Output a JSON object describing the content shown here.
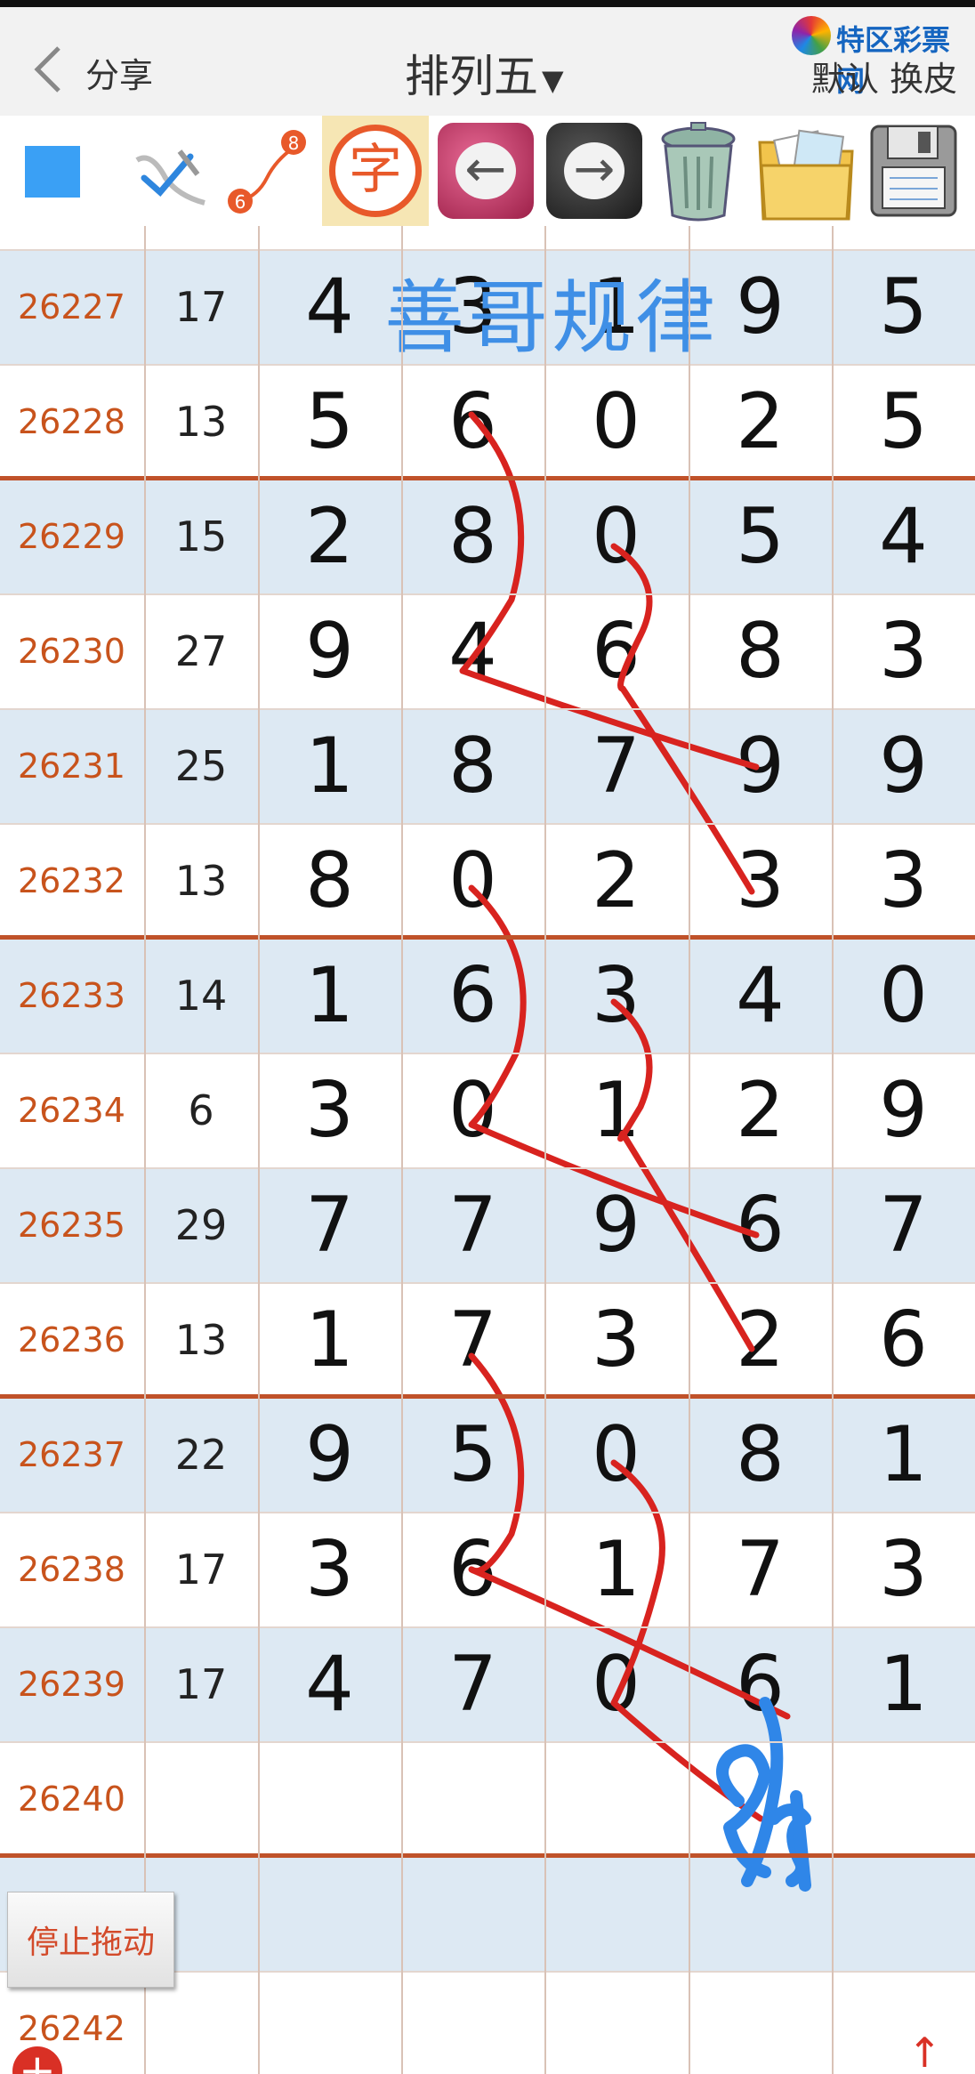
{
  "header": {
    "share_label": "分享",
    "title": "排列五",
    "logo_text": "特区彩票网",
    "skin_label": "默认 换皮"
  },
  "icons": {
    "back": "chevron-left-icon",
    "dropdown": "caret-down-icon",
    "color_swatch": "blue-square-icon",
    "pen": "pen-check-icon",
    "path": "route-6-8-icon",
    "text": "text-char-icon",
    "undo": "arrow-left-icon",
    "redo": "arrow-right-icon",
    "trash": "trash-can-icon",
    "folder": "photo-folder-icon",
    "save": "floppy-disk-icon"
  },
  "toolbar": {
    "path_from": "6",
    "path_to": "8",
    "char_label": "字"
  },
  "overlay": {
    "watermark": "善哥规律",
    "annotation": "94",
    "stroke_color": "#d8231f",
    "annotation_color": "#2f86e8"
  },
  "rows": [
    {
      "issue": "26227",
      "sum": "17",
      "d": [
        "4",
        "3",
        "1",
        "9",
        "5"
      ]
    },
    {
      "issue": "26228",
      "sum": "13",
      "d": [
        "5",
        "6",
        "0",
        "2",
        "5"
      ]
    },
    {
      "issue": "26229",
      "sum": "15",
      "d": [
        "2",
        "8",
        "0",
        "5",
        "4"
      ]
    },
    {
      "issue": "26230",
      "sum": "27",
      "d": [
        "9",
        "4",
        "6",
        "8",
        "3"
      ]
    },
    {
      "issue": "26231",
      "sum": "25",
      "d": [
        "1",
        "8",
        "7",
        "9",
        "9"
      ]
    },
    {
      "issue": "26232",
      "sum": "13",
      "d": [
        "8",
        "0",
        "2",
        "3",
        "3"
      ]
    },
    {
      "issue": "26233",
      "sum": "14",
      "d": [
        "1",
        "6",
        "3",
        "4",
        "0"
      ]
    },
    {
      "issue": "26234",
      "sum": "6",
      "d": [
        "3",
        "0",
        "1",
        "2",
        "9"
      ]
    },
    {
      "issue": "26235",
      "sum": "29",
      "d": [
        "7",
        "7",
        "9",
        "6",
        "7"
      ]
    },
    {
      "issue": "26236",
      "sum": "13",
      "d": [
        "1",
        "7",
        "3",
        "2",
        "6"
      ]
    },
    {
      "issue": "26237",
      "sum": "22",
      "d": [
        "9",
        "5",
        "0",
        "8",
        "1"
      ]
    },
    {
      "issue": "26238",
      "sum": "17",
      "d": [
        "3",
        "6",
        "1",
        "7",
        "3"
      ]
    },
    {
      "issue": "26239",
      "sum": "17",
      "d": [
        "4",
        "7",
        "0",
        "6",
        "1"
      ]
    },
    {
      "issue": "26240",
      "sum": "",
      "d": [
        "",
        "",
        "",
        "",
        ""
      ]
    },
    {
      "issue": "",
      "sum": "",
      "d": [
        "",
        "",
        "",
        "",
        ""
      ]
    },
    {
      "issue": "26242",
      "sum": "",
      "d": [
        "",
        "",
        "",
        "",
        ""
      ]
    }
  ],
  "buttons": {
    "stop_drag": "停止拖动",
    "add": "+",
    "scroll_up": "↑"
  },
  "colors": {
    "issue_text": "#c8531c",
    "row_shade": "#dde9f3",
    "separator": "#c0522a",
    "accent_blue": "#3aa0f5"
  }
}
